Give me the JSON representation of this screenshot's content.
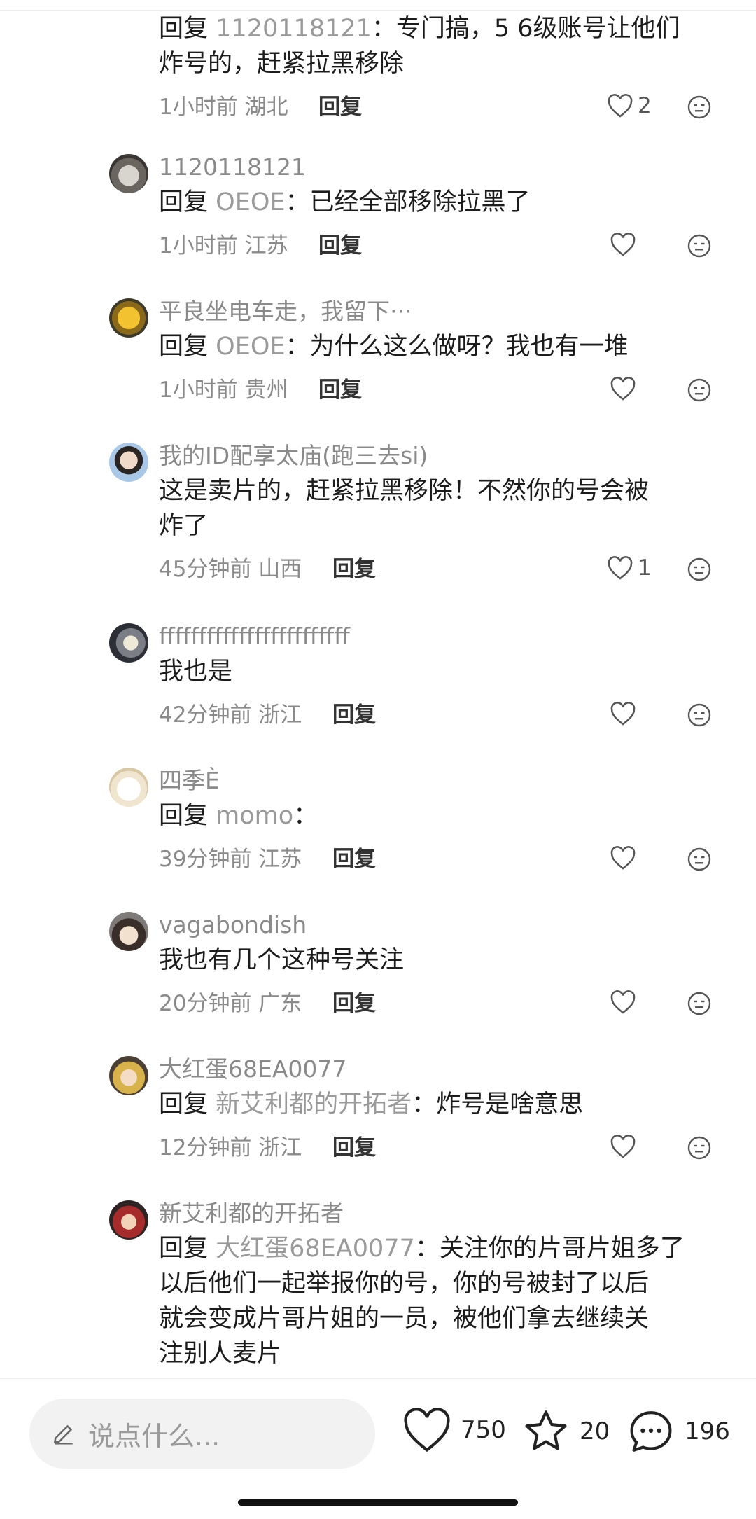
{
  "comments": [
    {
      "author": "",
      "reply_label": "回复",
      "reply_to": "1120118121",
      "text_lines": [
        "专门搞，5 6级账号让他们",
        "炸号的，赶紧拉黑移除"
      ],
      "time_loc": "1小时前 湖北",
      "reply_btn": "回复",
      "likes": "2"
    },
    {
      "author": "1120118121",
      "reply_label": "回复",
      "reply_to": "OEOE",
      "text_lines": [
        "已经全部移除拉黑了"
      ],
      "time_loc": "1小时前 江苏",
      "reply_btn": "回复",
      "likes": ""
    },
    {
      "author": "平良坐电车走，我留下···",
      "reply_label": "回复",
      "reply_to": "OEOE",
      "text_lines": [
        "为什么这么做呀？我也有一堆"
      ],
      "time_loc": "1小时前 贵州",
      "reply_btn": "回复",
      "likes": ""
    },
    {
      "author": "我的ID配享太庙(跑三去si)",
      "reply_label": "",
      "reply_to": "",
      "text_lines": [
        "这是卖片的，赶紧拉黑移除！不然你的号会被",
        "炸了"
      ],
      "time_loc": "45分钟前 山西",
      "reply_btn": "回复",
      "likes": "1"
    },
    {
      "author": "ffffffffffffffffffffffff",
      "reply_label": "",
      "reply_to": "",
      "text_lines": [
        "我也是"
      ],
      "time_loc": "42分钟前 浙江",
      "reply_btn": "回复",
      "likes": ""
    },
    {
      "author": "四季È",
      "reply_label": "回复",
      "reply_to": "momo",
      "text_lines": [
        ""
      ],
      "time_loc": "39分钟前 江苏",
      "reply_btn": "回复",
      "likes": ""
    },
    {
      "author": "vagabondish",
      "reply_label": "",
      "reply_to": "",
      "text_lines": [
        "我也有几个这种号关注"
      ],
      "time_loc": "20分钟前 广东",
      "reply_btn": "回复",
      "likes": ""
    },
    {
      "author": "大红蛋68EA0077",
      "reply_label": "回复",
      "reply_to": "新艾利都的开拓者",
      "text_lines": [
        "炸号是啥意思"
      ],
      "time_loc": "12分钟前 浙江",
      "reply_btn": "回复",
      "likes": ""
    },
    {
      "author": "新艾利都的开拓者",
      "reply_label": "回复",
      "reply_to": "大红蛋68EA0077",
      "text_lines": [
        "关注你的片哥片姐多了",
        "以后他们一起举报你的号，你的号被封了以后",
        "就会变成片哥片姐的一员，被他们拿去继续关",
        "注别人麦片"
      ],
      "time_loc": "",
      "reply_btn": "",
      "likes": ""
    }
  ],
  "colon": "：",
  "bottom_bar": {
    "input_placeholder": "说点什么...",
    "like_count": "750",
    "star_count": "20",
    "comment_count": "196"
  },
  "icons": {
    "like": "heart-icon",
    "dislike": "neutral-face-icon",
    "pencil": "pencil-icon",
    "star": "star-icon",
    "comment": "speech-bubble-icon"
  },
  "colors": {
    "secondary_text": "#8a8a8a",
    "body_text": "#1c1c1c",
    "input_bg": "#f2f2f2"
  }
}
